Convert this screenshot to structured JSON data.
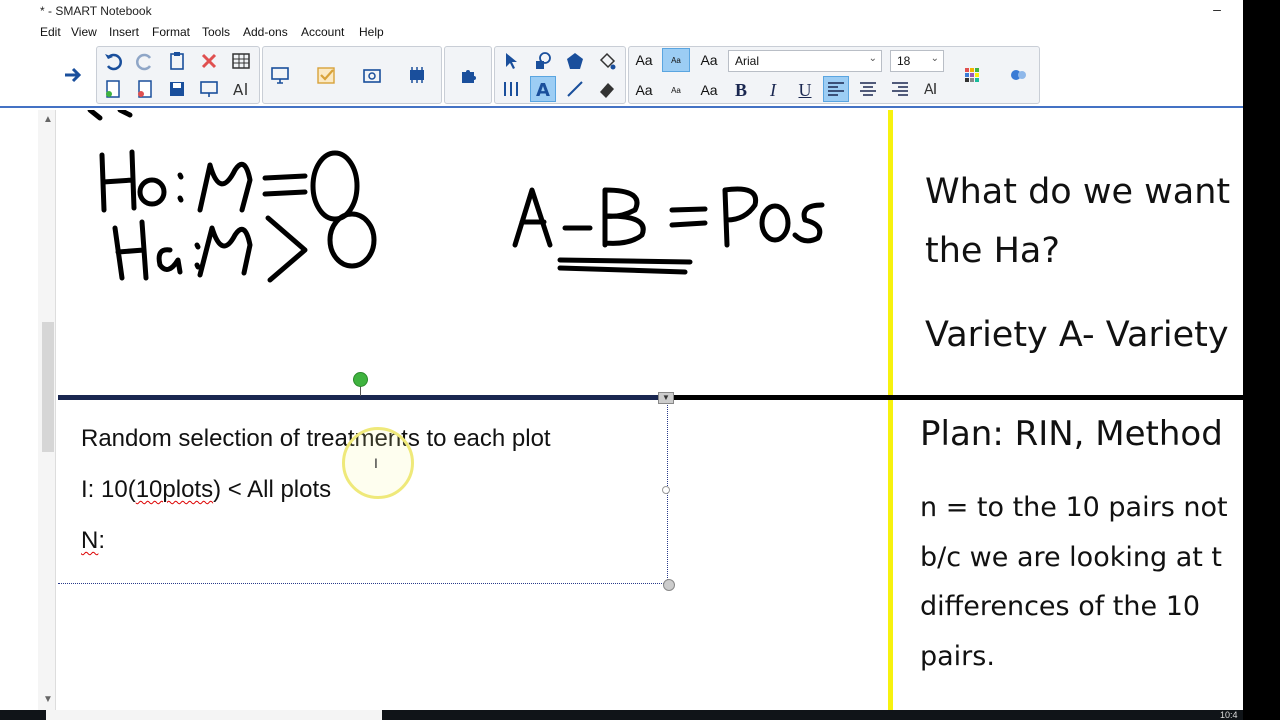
{
  "window": {
    "title": "* - SMART Notebook",
    "minimize": "–"
  },
  "menu": [
    "Edit",
    "View",
    "Insert",
    "Format",
    "Tools",
    "Add-ons",
    "Account",
    "Help"
  ],
  "toolbar": {
    "font_name": "Arial",
    "font_size": "18",
    "text_style_top": [
      "Aa",
      "Aa",
      "Aa"
    ],
    "text_style_bottom": [
      "Aa",
      "Aa",
      "Aa"
    ],
    "bold": "B",
    "italic": "I",
    "underline": "U"
  },
  "colors": {
    "accent": "#4472c4",
    "yellow_line": "#f7f20f",
    "handle": "#3fb33f"
  },
  "whiteboard": {
    "handwriting": {
      "h0": "Ho: μ = 0",
      "ha": "Ha: μ > 0",
      "diff": "A - B = Pos"
    },
    "textbox": {
      "line1": "Random selection of treatments to each plot",
      "line2_prefix": "I: 10(",
      "line2_spell": "10plots",
      "line2_suffix": ") < All plots",
      "line3_spell": "N",
      "line3_suffix": ":"
    },
    "right_panel": {
      "q1": "What do we want",
      "q2": "the Ha?",
      "variety": "Variety A- Variety",
      "plan": "Plan:  RIN, Method",
      "n1": "n = to the 10 pairs not",
      "n2": "b/c we are looking at t",
      "n3": "differences of the 10",
      "n4": "pairs."
    }
  },
  "taskbar": {
    "clock": "10:4"
  }
}
